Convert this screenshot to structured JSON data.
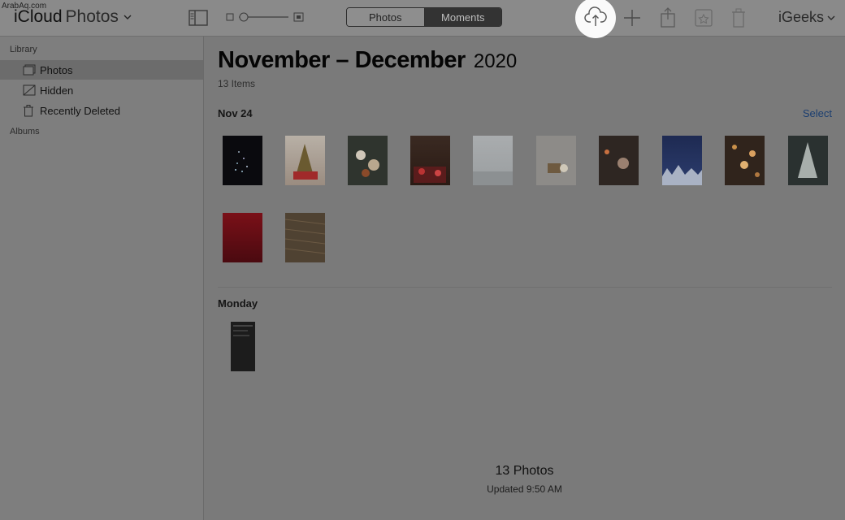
{
  "watermark": "ArabAq.com",
  "app": {
    "brand": "iCloud",
    "section": "Photos"
  },
  "view_switcher": {
    "options": [
      "Photos",
      "Moments"
    ],
    "selected": "Moments"
  },
  "account": {
    "name": "iGeeks"
  },
  "sidebar": {
    "library_label": "Library",
    "items": [
      {
        "label": "Photos",
        "icon": "photos-icon",
        "selected": true
      },
      {
        "label": "Hidden",
        "icon": "hidden-icon",
        "selected": false
      },
      {
        "label": "Recently Deleted",
        "icon": "trash-icon",
        "selected": false
      }
    ],
    "albums_label": "Albums"
  },
  "main": {
    "title": "November – December",
    "year": "2020",
    "item_count": "13 Items",
    "groups": [
      {
        "label": "Nov 24",
        "action": "Select",
        "photo_count": 12
      },
      {
        "label": "Monday",
        "photo_count": 1
      }
    ],
    "footer": {
      "count": "13 Photos",
      "updated": "Updated 9:50 AM"
    }
  },
  "colors": {
    "accent": "#1b3e70",
    "highlight": "#fafafa",
    "dim_background": "#7a7a7a"
  }
}
